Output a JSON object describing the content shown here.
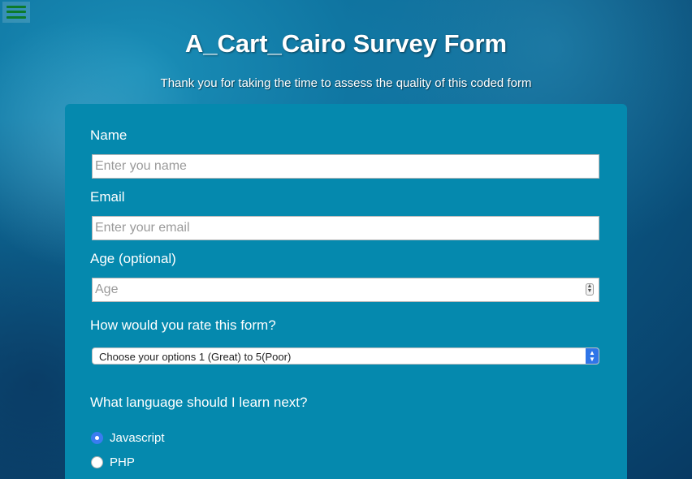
{
  "page": {
    "menu_icon": "hamburger-menu-icon",
    "title": "A_Cart_Cairo Survey Form",
    "subtitle": "Thank you for taking the time to assess the quality of this coded form"
  },
  "form": {
    "name": {
      "label": "Name",
      "placeholder": "Enter you name",
      "value": ""
    },
    "email": {
      "label": "Email",
      "placeholder": "Enter your email",
      "value": ""
    },
    "age": {
      "label": "Age (optional)",
      "placeholder": "Age",
      "value": ""
    },
    "rating": {
      "label": "How would you rate this form?",
      "selected": "Choose your options 1 (Great) to 5(Poor)"
    },
    "language": {
      "label": "What language should I learn next?",
      "options": [
        {
          "label": "Javascript",
          "checked": true
        },
        {
          "label": "PHP",
          "checked": false
        }
      ]
    }
  },
  "colors": {
    "card": "#0589ae",
    "accent": "#3a7cf0",
    "menu_icon": "#0c7a2a"
  }
}
